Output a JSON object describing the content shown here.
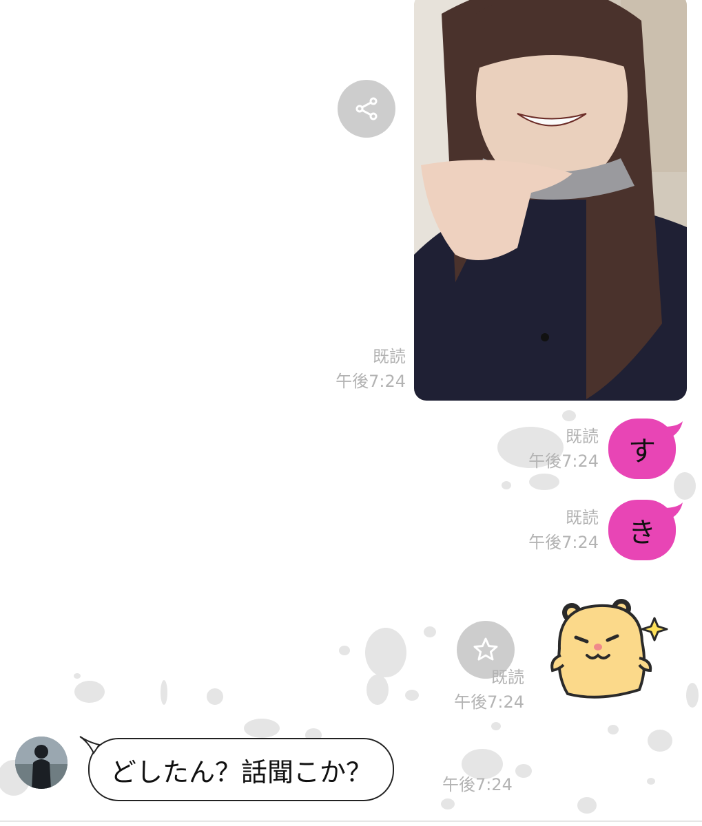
{
  "messages": {
    "photo": {
      "read_label": "既読",
      "time": "午後7:24"
    },
    "msg_su": {
      "text": "す",
      "read_label": "既読",
      "time": "午後7:24"
    },
    "msg_ki": {
      "text": "き",
      "read_label": "既読",
      "time": "午後7:24"
    },
    "sticker": {
      "read_label": "既読",
      "time": "午後7:24"
    },
    "incoming": {
      "text": "どしたん？話聞こか？",
      "time": "午後7:24"
    }
  },
  "icons": {
    "share": "share-icon",
    "star": "star-icon"
  },
  "colors": {
    "outgoing_bubble": "#e845b5",
    "meta_text": "#b3b3b3",
    "action_circle": "#cdcdcd",
    "sticker_body": "#fbd98a"
  }
}
